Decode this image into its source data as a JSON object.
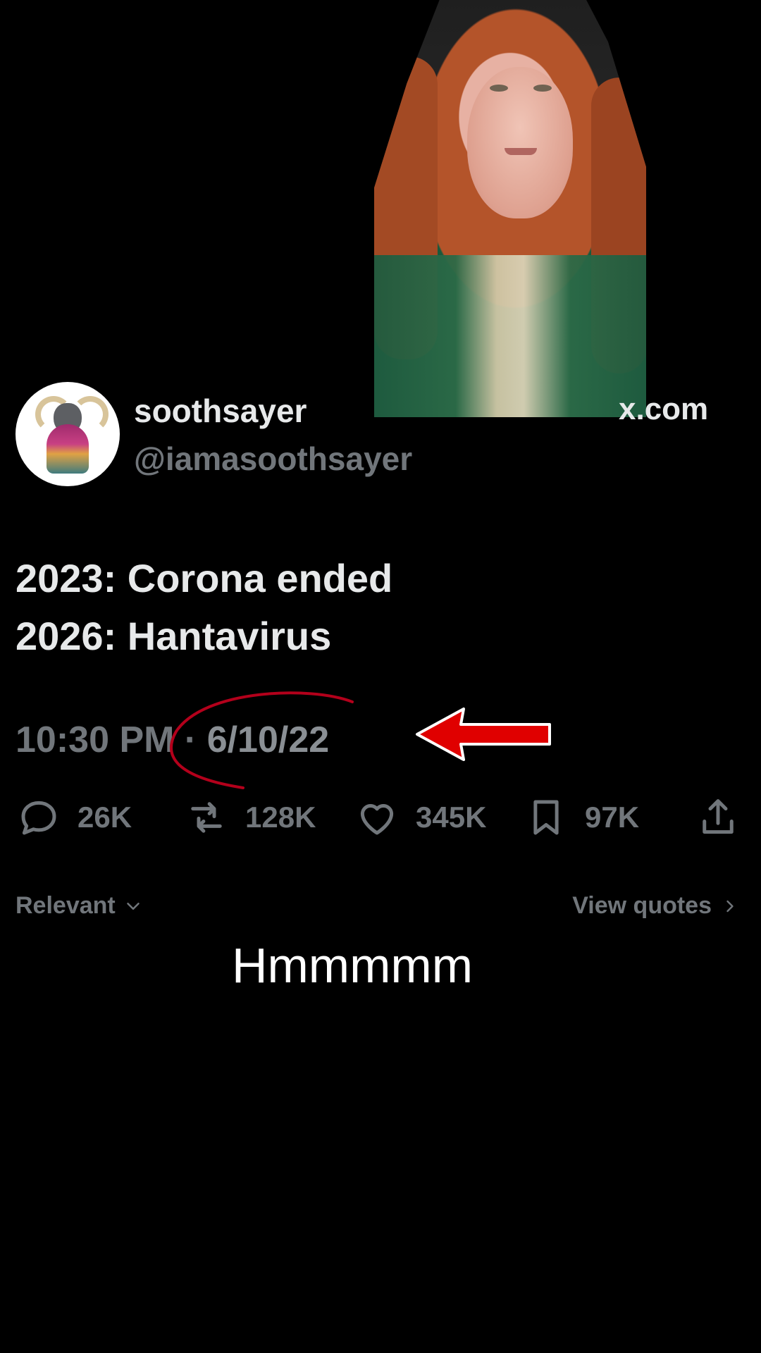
{
  "post": {
    "display_name": "soothsayer",
    "handle": "@iamasoothsayer",
    "domain_fragment": "x.com",
    "lines": [
      "2023: Corona ended",
      "2026: Hantavirus"
    ],
    "time": "10:30 PM",
    "separator": "·",
    "date": "6/10/22"
  },
  "actions": {
    "reply_count": "26K",
    "repost_count": "128K",
    "like_count": "345K",
    "bookmark_count": "97K"
  },
  "replies_header": {
    "sort_label": "Relevant",
    "view_quotes_label": "View quotes"
  },
  "overlay": {
    "caption": "Hmmmmm"
  },
  "colors": {
    "background": "#000000",
    "text_primary": "#e7e9ea",
    "text_secondary": "#71767b",
    "annotation_red": "#b3001b",
    "arrow_red": "#e00000"
  }
}
